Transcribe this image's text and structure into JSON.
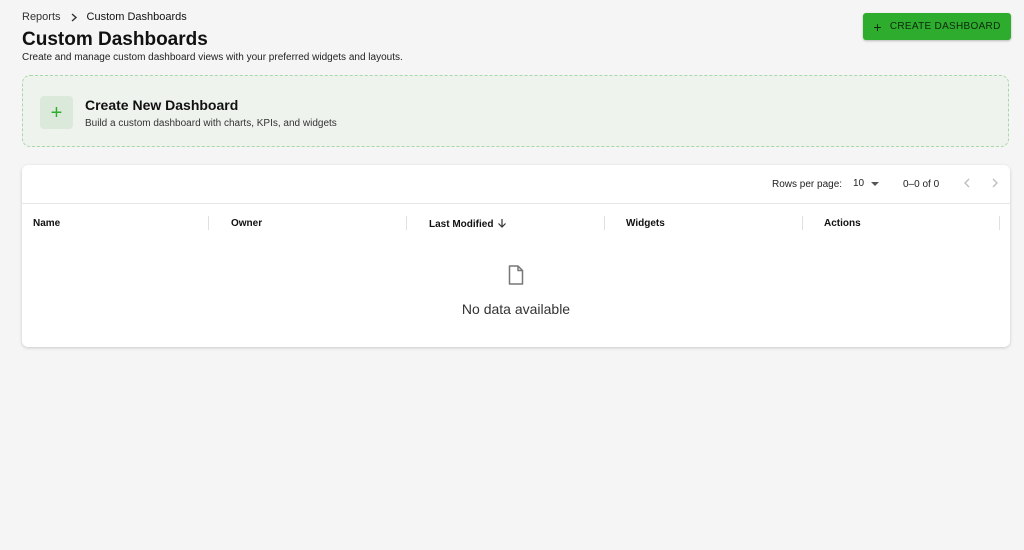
{
  "breadcrumb": {
    "parent": "Reports",
    "current": "Custom Dashboards"
  },
  "header": {
    "title": "Custom Dashboards",
    "subtitle": "Create and manage custom dashboard views with your preferred widgets and layouts.",
    "create_button_label": "CREATE DASHBOARD"
  },
  "new_card": {
    "title": "Create New Dashboard",
    "description": "Build a custom dashboard with charts, KPIs, and widgets"
  },
  "pagination": {
    "rows_per_page_label": "Rows per page:",
    "rows_per_page_value": "10",
    "range": "0–0 of 0"
  },
  "table": {
    "columns": [
      "Name",
      "Owner",
      "Last Modified",
      "Widgets",
      "Actions"
    ],
    "empty_message": "No data available"
  },
  "icons": {
    "breadcrumb_separator": "chevron-right-icon",
    "create": "plus-icon",
    "sort": "arrow-down-icon",
    "empty": "document-icon",
    "prev": "chevron-left-icon",
    "next": "chevron-right-icon"
  },
  "colors": {
    "accent": "#2eac2e",
    "accent_light": "#eef3ee",
    "dashed_border": "#a8d8a8"
  }
}
